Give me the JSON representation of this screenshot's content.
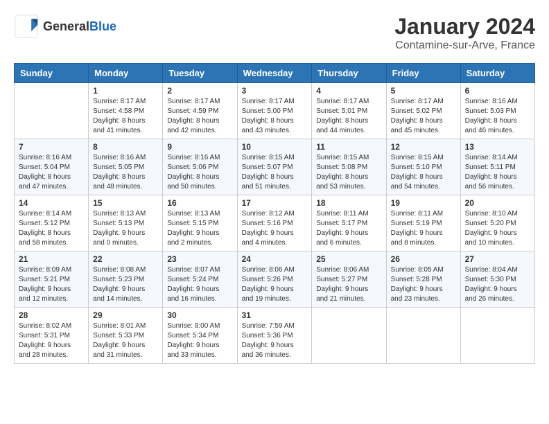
{
  "header": {
    "logo_general": "General",
    "logo_blue": "Blue",
    "month_title": "January 2024",
    "location": "Contamine-sur-Arve, France"
  },
  "weekdays": [
    "Sunday",
    "Monday",
    "Tuesday",
    "Wednesday",
    "Thursday",
    "Friday",
    "Saturday"
  ],
  "weeks": [
    [
      {
        "day": "",
        "info": ""
      },
      {
        "day": "1",
        "info": "Sunrise: 8:17 AM\nSunset: 4:58 PM\nDaylight: 8 hours\nand 41 minutes."
      },
      {
        "day": "2",
        "info": "Sunrise: 8:17 AM\nSunset: 4:59 PM\nDaylight: 8 hours\nand 42 minutes."
      },
      {
        "day": "3",
        "info": "Sunrise: 8:17 AM\nSunset: 5:00 PM\nDaylight: 8 hours\nand 43 minutes."
      },
      {
        "day": "4",
        "info": "Sunrise: 8:17 AM\nSunset: 5:01 PM\nDaylight: 8 hours\nand 44 minutes."
      },
      {
        "day": "5",
        "info": "Sunrise: 8:17 AM\nSunset: 5:02 PM\nDaylight: 8 hours\nand 45 minutes."
      },
      {
        "day": "6",
        "info": "Sunrise: 8:16 AM\nSunset: 5:03 PM\nDaylight: 8 hours\nand 46 minutes."
      }
    ],
    [
      {
        "day": "7",
        "info": "Sunrise: 8:16 AM\nSunset: 5:04 PM\nDaylight: 8 hours\nand 47 minutes."
      },
      {
        "day": "8",
        "info": "Sunrise: 8:16 AM\nSunset: 5:05 PM\nDaylight: 8 hours\nand 48 minutes."
      },
      {
        "day": "9",
        "info": "Sunrise: 8:16 AM\nSunset: 5:06 PM\nDaylight: 8 hours\nand 50 minutes."
      },
      {
        "day": "10",
        "info": "Sunrise: 8:15 AM\nSunset: 5:07 PM\nDaylight: 8 hours\nand 51 minutes."
      },
      {
        "day": "11",
        "info": "Sunrise: 8:15 AM\nSunset: 5:08 PM\nDaylight: 8 hours\nand 53 minutes."
      },
      {
        "day": "12",
        "info": "Sunrise: 8:15 AM\nSunset: 5:10 PM\nDaylight: 8 hours\nand 54 minutes."
      },
      {
        "day": "13",
        "info": "Sunrise: 8:14 AM\nSunset: 5:11 PM\nDaylight: 8 hours\nand 56 minutes."
      }
    ],
    [
      {
        "day": "14",
        "info": "Sunrise: 8:14 AM\nSunset: 5:12 PM\nDaylight: 8 hours\nand 58 minutes."
      },
      {
        "day": "15",
        "info": "Sunrise: 8:13 AM\nSunset: 5:13 PM\nDaylight: 9 hours\nand 0 minutes."
      },
      {
        "day": "16",
        "info": "Sunrise: 8:13 AM\nSunset: 5:15 PM\nDaylight: 9 hours\nand 2 minutes."
      },
      {
        "day": "17",
        "info": "Sunrise: 8:12 AM\nSunset: 5:16 PM\nDaylight: 9 hours\nand 4 minutes."
      },
      {
        "day": "18",
        "info": "Sunrise: 8:11 AM\nSunset: 5:17 PM\nDaylight: 9 hours\nand 6 minutes."
      },
      {
        "day": "19",
        "info": "Sunrise: 8:11 AM\nSunset: 5:19 PM\nDaylight: 9 hours\nand 8 minutes."
      },
      {
        "day": "20",
        "info": "Sunrise: 8:10 AM\nSunset: 5:20 PM\nDaylight: 9 hours\nand 10 minutes."
      }
    ],
    [
      {
        "day": "21",
        "info": "Sunrise: 8:09 AM\nSunset: 5:21 PM\nDaylight: 9 hours\nand 12 minutes."
      },
      {
        "day": "22",
        "info": "Sunrise: 8:08 AM\nSunset: 5:23 PM\nDaylight: 9 hours\nand 14 minutes."
      },
      {
        "day": "23",
        "info": "Sunrise: 8:07 AM\nSunset: 5:24 PM\nDaylight: 9 hours\nand 16 minutes."
      },
      {
        "day": "24",
        "info": "Sunrise: 8:06 AM\nSunset: 5:26 PM\nDaylight: 9 hours\nand 19 minutes."
      },
      {
        "day": "25",
        "info": "Sunrise: 8:06 AM\nSunset: 5:27 PM\nDaylight: 9 hours\nand 21 minutes."
      },
      {
        "day": "26",
        "info": "Sunrise: 8:05 AM\nSunset: 5:28 PM\nDaylight: 9 hours\nand 23 minutes."
      },
      {
        "day": "27",
        "info": "Sunrise: 8:04 AM\nSunset: 5:30 PM\nDaylight: 9 hours\nand 26 minutes."
      }
    ],
    [
      {
        "day": "28",
        "info": "Sunrise: 8:02 AM\nSunset: 5:31 PM\nDaylight: 9 hours\nand 28 minutes."
      },
      {
        "day": "29",
        "info": "Sunrise: 8:01 AM\nSunset: 5:33 PM\nDaylight: 9 hours\nand 31 minutes."
      },
      {
        "day": "30",
        "info": "Sunrise: 8:00 AM\nSunset: 5:34 PM\nDaylight: 9 hours\nand 33 minutes."
      },
      {
        "day": "31",
        "info": "Sunrise: 7:59 AM\nSunset: 5:36 PM\nDaylight: 9 hours\nand 36 minutes."
      },
      {
        "day": "",
        "info": ""
      },
      {
        "day": "",
        "info": ""
      },
      {
        "day": "",
        "info": ""
      }
    ]
  ]
}
